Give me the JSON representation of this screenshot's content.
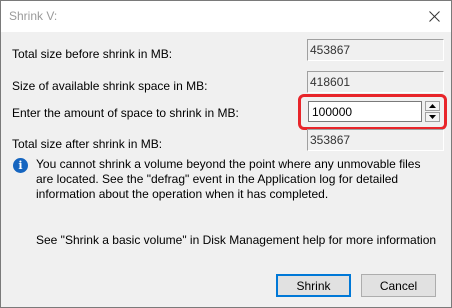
{
  "window": {
    "title": "Shrink V:",
    "close_icon": "close-icon"
  },
  "fields": {
    "total_size_label": "Total size before shrink in MB:",
    "total_size_value": "453867",
    "available_label": "Size of available shrink space in MB:",
    "available_value": "418601",
    "shrink_amount_label": "Enter the amount of space to shrink in MB:",
    "shrink_amount_value": "100000",
    "after_label": "Total size after shrink in MB:",
    "after_value": "353867"
  },
  "info": {
    "icon": "info-icon",
    "message": "You cannot shrink a volume beyond the point where any unmovable files are located. See the \"defrag\" event in the Application log for detailed information about the operation when it has completed.",
    "help": "See \"Shrink a basic volume\" in Disk Management help for more information"
  },
  "buttons": {
    "shrink": "Shrink",
    "cancel": "Cancel"
  },
  "colors": {
    "highlight": "#e8252a",
    "info_icon": "#1565c0",
    "default_button_border": "#0078d7"
  }
}
